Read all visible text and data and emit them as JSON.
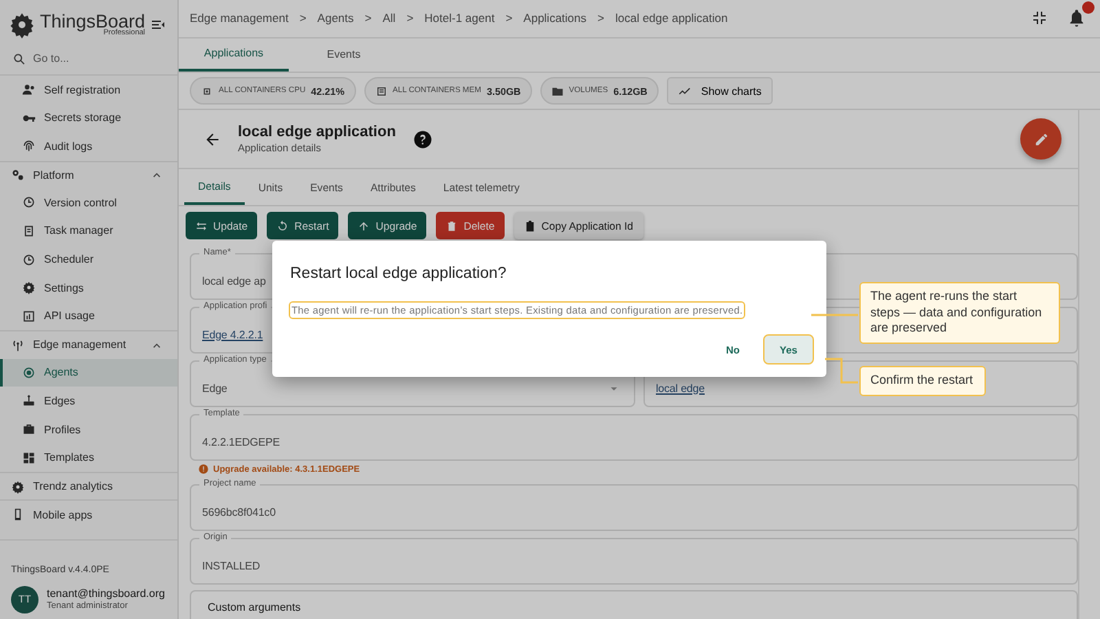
{
  "app": {
    "logo": "ThingsBoard",
    "edition": "Professional"
  },
  "sidebar": {
    "search": {
      "placeholder": "Go to..."
    },
    "items": [
      {
        "kind": "sub",
        "label": "Self registration",
        "selected": false
      },
      {
        "kind": "sub",
        "label": "Secrets storage",
        "selected": false
      },
      {
        "kind": "sub",
        "label": "Audit logs",
        "selected": false
      },
      {
        "kind": "section",
        "label": "Platform",
        "expanded": true,
        "children": [
          {
            "label": "Version control",
            "selected": false
          },
          {
            "label": "Task manager",
            "selected": false
          },
          {
            "label": "Scheduler",
            "selected": false
          },
          {
            "label": "Settings",
            "selected": false
          },
          {
            "label": "API usage",
            "selected": false
          }
        ]
      },
      {
        "kind": "section",
        "label": "Edge management",
        "expanded": true,
        "children": [
          {
            "label": "Agents",
            "selected": true
          },
          {
            "label": "Edges",
            "selected": false
          },
          {
            "label": "Profiles",
            "selected": false
          },
          {
            "label": "Templates",
            "selected": false
          }
        ]
      },
      {
        "kind": "top",
        "label": "Trendz analytics",
        "selected": false
      },
      {
        "kind": "top",
        "label": "Mobile apps",
        "selected": false
      }
    ],
    "version": "ThingsBoard v.4.4.0PE",
    "user": {
      "initials": "TT",
      "email": "tenant@thingsboard.org",
      "role": "Tenant administrator"
    }
  },
  "topbar": {
    "breadcrumbs": [
      {
        "label": "Edge management"
      },
      {
        "label": "Agents"
      },
      {
        "label": "All"
      },
      {
        "label": "Hotel-1 agent"
      },
      {
        "label": "Applications"
      },
      {
        "label": "local edge application"
      }
    ],
    "separators": [
      ">",
      ">",
      ">",
      ">",
      ">"
    ]
  },
  "page_tabs": [
    {
      "label": "Applications",
      "selected": true
    },
    {
      "label": "Events",
      "selected": false
    }
  ],
  "stats": [
    {
      "label": "ALL CONTAINERS CPU",
      "value": "42.21%"
    },
    {
      "label": "ALL CONTAINERS MEM",
      "value": "3.50GB"
    },
    {
      "label": "VOLUMES",
      "value": "6.12GB"
    }
  ],
  "show_charts": "Show charts",
  "details": {
    "title": "local edge application",
    "subtitle": "Application details",
    "tabs": [
      {
        "label": "Details",
        "selected": true
      },
      {
        "label": "Units",
        "selected": false
      },
      {
        "label": "Events",
        "selected": false
      },
      {
        "label": "Attributes",
        "selected": false
      },
      {
        "label": "Latest telemetry",
        "selected": false
      }
    ],
    "actions": [
      {
        "kind": "update",
        "label": "Update"
      },
      {
        "kind": "restart",
        "label": "Restart"
      },
      {
        "kind": "upgrade",
        "label": "Upgrade"
      },
      {
        "kind": "delete",
        "label": "Delete"
      },
      {
        "kind": "copy",
        "label": "Copy Application Id"
      }
    ],
    "fields": [
      [
        {
          "kind": "text",
          "label": "Name*",
          "value": "local edge ap"
        }
      ],
      [
        {
          "kind": "link",
          "label": "Application profi",
          "value": "Edge 4.2.2.1"
        }
      ],
      [
        {
          "kind": "select",
          "label": "Application type",
          "value": "Edge"
        },
        {
          "kind": "link",
          "value": "local edge"
        }
      ],
      [
        {
          "kind": "text",
          "label": "Template",
          "value": "4.2.2.1EDGEPE",
          "warning": "Upgrade available: 4.3.1.1EDGEPE"
        }
      ],
      [
        {
          "kind": "text",
          "label": "Project name",
          "value": "5696bc8f041c0"
        }
      ],
      [
        {
          "kind": "text",
          "label": "Origin",
          "value": "INSTALLED"
        }
      ]
    ],
    "section": "Custom arguments"
  },
  "dialog": {
    "title": "Restart local edge application?",
    "message": {
      "text": "The agent will re-run the application’s start steps. Existing data and configuration are preserved.",
      "highlighted": true
    },
    "buttons": [
      {
        "label": "No",
        "highlighted": false
      },
      {
        "label": "Yes",
        "highlighted": true
      }
    ]
  },
  "callouts": [
    {
      "text": "The agent re-runs the start steps — data and configuration are preserved"
    },
    {
      "text": "Confirm the restart"
    }
  ]
}
